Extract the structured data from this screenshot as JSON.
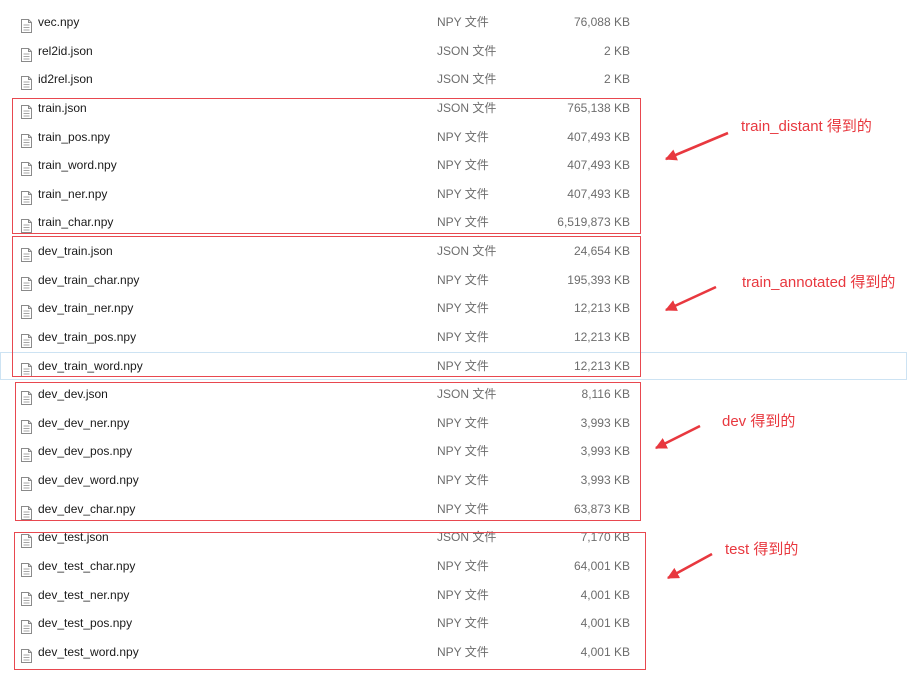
{
  "files": [
    {
      "name": "vec.npy",
      "type": "NPY 文件",
      "size": "76,088 KB"
    },
    {
      "name": "rel2id.json",
      "type": "JSON 文件",
      "size": "2 KB"
    },
    {
      "name": "id2rel.json",
      "type": "JSON 文件",
      "size": "2 KB"
    },
    {
      "name": "train.json",
      "type": "JSON 文件",
      "size": "765,138 KB"
    },
    {
      "name": "train_pos.npy",
      "type": "NPY 文件",
      "size": "407,493 KB"
    },
    {
      "name": "train_word.npy",
      "type": "NPY 文件",
      "size": "407,493 KB"
    },
    {
      "name": "train_ner.npy",
      "type": "NPY 文件",
      "size": "407,493 KB"
    },
    {
      "name": "train_char.npy",
      "type": "NPY 文件",
      "size": "6,519,873 KB"
    },
    {
      "name": "dev_train.json",
      "type": "JSON 文件",
      "size": "24,654 KB"
    },
    {
      "name": "dev_train_char.npy",
      "type": "NPY 文件",
      "size": "195,393 KB"
    },
    {
      "name": "dev_train_ner.npy",
      "type": "NPY 文件",
      "size": "12,213 KB"
    },
    {
      "name": "dev_train_pos.npy",
      "type": "NPY 文件",
      "size": "12,213 KB"
    },
    {
      "name": "dev_train_word.npy",
      "type": "NPY 文件",
      "size": "12,213 KB"
    },
    {
      "name": "dev_dev.json",
      "type": "JSON 文件",
      "size": "8,116 KB"
    },
    {
      "name": "dev_dev_ner.npy",
      "type": "NPY 文件",
      "size": "3,993 KB"
    },
    {
      "name": "dev_dev_pos.npy",
      "type": "NPY 文件",
      "size": "3,993 KB"
    },
    {
      "name": "dev_dev_word.npy",
      "type": "NPY 文件",
      "size": "3,993 KB"
    },
    {
      "name": "dev_dev_char.npy",
      "type": "NPY 文件",
      "size": "63,873 KB"
    },
    {
      "name": "dev_test.json",
      "type": "JSON 文件",
      "size": "7,170 KB"
    },
    {
      "name": "dev_test_char.npy",
      "type": "NPY 文件",
      "size": "64,001 KB"
    },
    {
      "name": "dev_test_ner.npy",
      "type": "NPY 文件",
      "size": "4,001 KB"
    },
    {
      "name": "dev_test_pos.npy",
      "type": "NPY 文件",
      "size": "4,001 KB"
    },
    {
      "name": "dev_test_word.npy",
      "type": "NPY 文件",
      "size": "4,001 KB"
    }
  ],
  "annotations": [
    {
      "label": "train_distant 得到的"
    },
    {
      "label": "train_annotated 得到的"
    },
    {
      "label": "dev 得到的"
    },
    {
      "label": "test 得到的"
    }
  ],
  "colors": {
    "annotation": "#e8383f",
    "box_border": "#e8484f",
    "hover_outline": "#cde3f3"
  },
  "icons": {
    "file": "document-file-icon",
    "arrow": "red-arrow-icon"
  }
}
